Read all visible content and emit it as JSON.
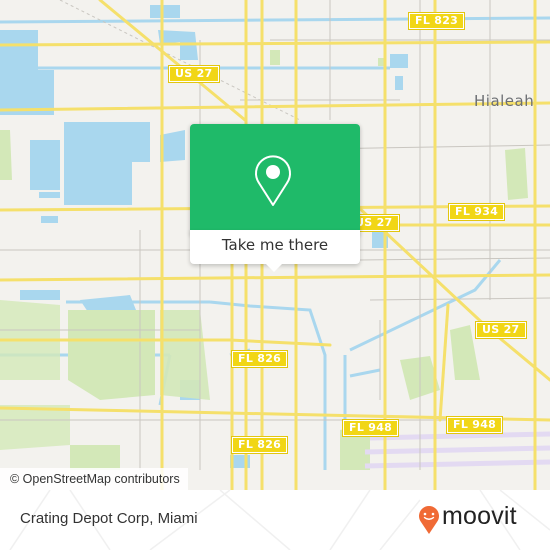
{
  "map": {
    "place_labels": [
      {
        "id": "hialeah",
        "text": "Hialeah"
      }
    ],
    "road_shields": [
      {
        "id": "fl823",
        "text": "FL 823"
      },
      {
        "id": "us27-north",
        "text": "US 27"
      },
      {
        "id": "us27-center",
        "text": "US 27"
      },
      {
        "id": "fl934",
        "text": "FL 934"
      },
      {
        "id": "us27-east",
        "text": "US 27"
      },
      {
        "id": "fl826-north",
        "text": "FL 826"
      },
      {
        "id": "fl826-south",
        "text": "FL 826"
      },
      {
        "id": "fl948-west",
        "text": "FL 948"
      },
      {
        "id": "fl948-east",
        "text": "FL 948"
      }
    ],
    "attribution": "© OpenStreetMap contributors",
    "colors": {
      "land": "#f3f2ee",
      "water": "#a9d7ee",
      "park": "#d3e8b8",
      "road": "#f5e06b",
      "minor_road": "#c9c6c0",
      "airport_runway": "#e3daf2"
    }
  },
  "popup": {
    "icon": "map-pin-icon",
    "action_label": "Take me there",
    "color": "#1fba69"
  },
  "footer": {
    "title": "Crating Depot Corp, Miami",
    "brand": "moovit",
    "brand_color": "#f06a35"
  }
}
